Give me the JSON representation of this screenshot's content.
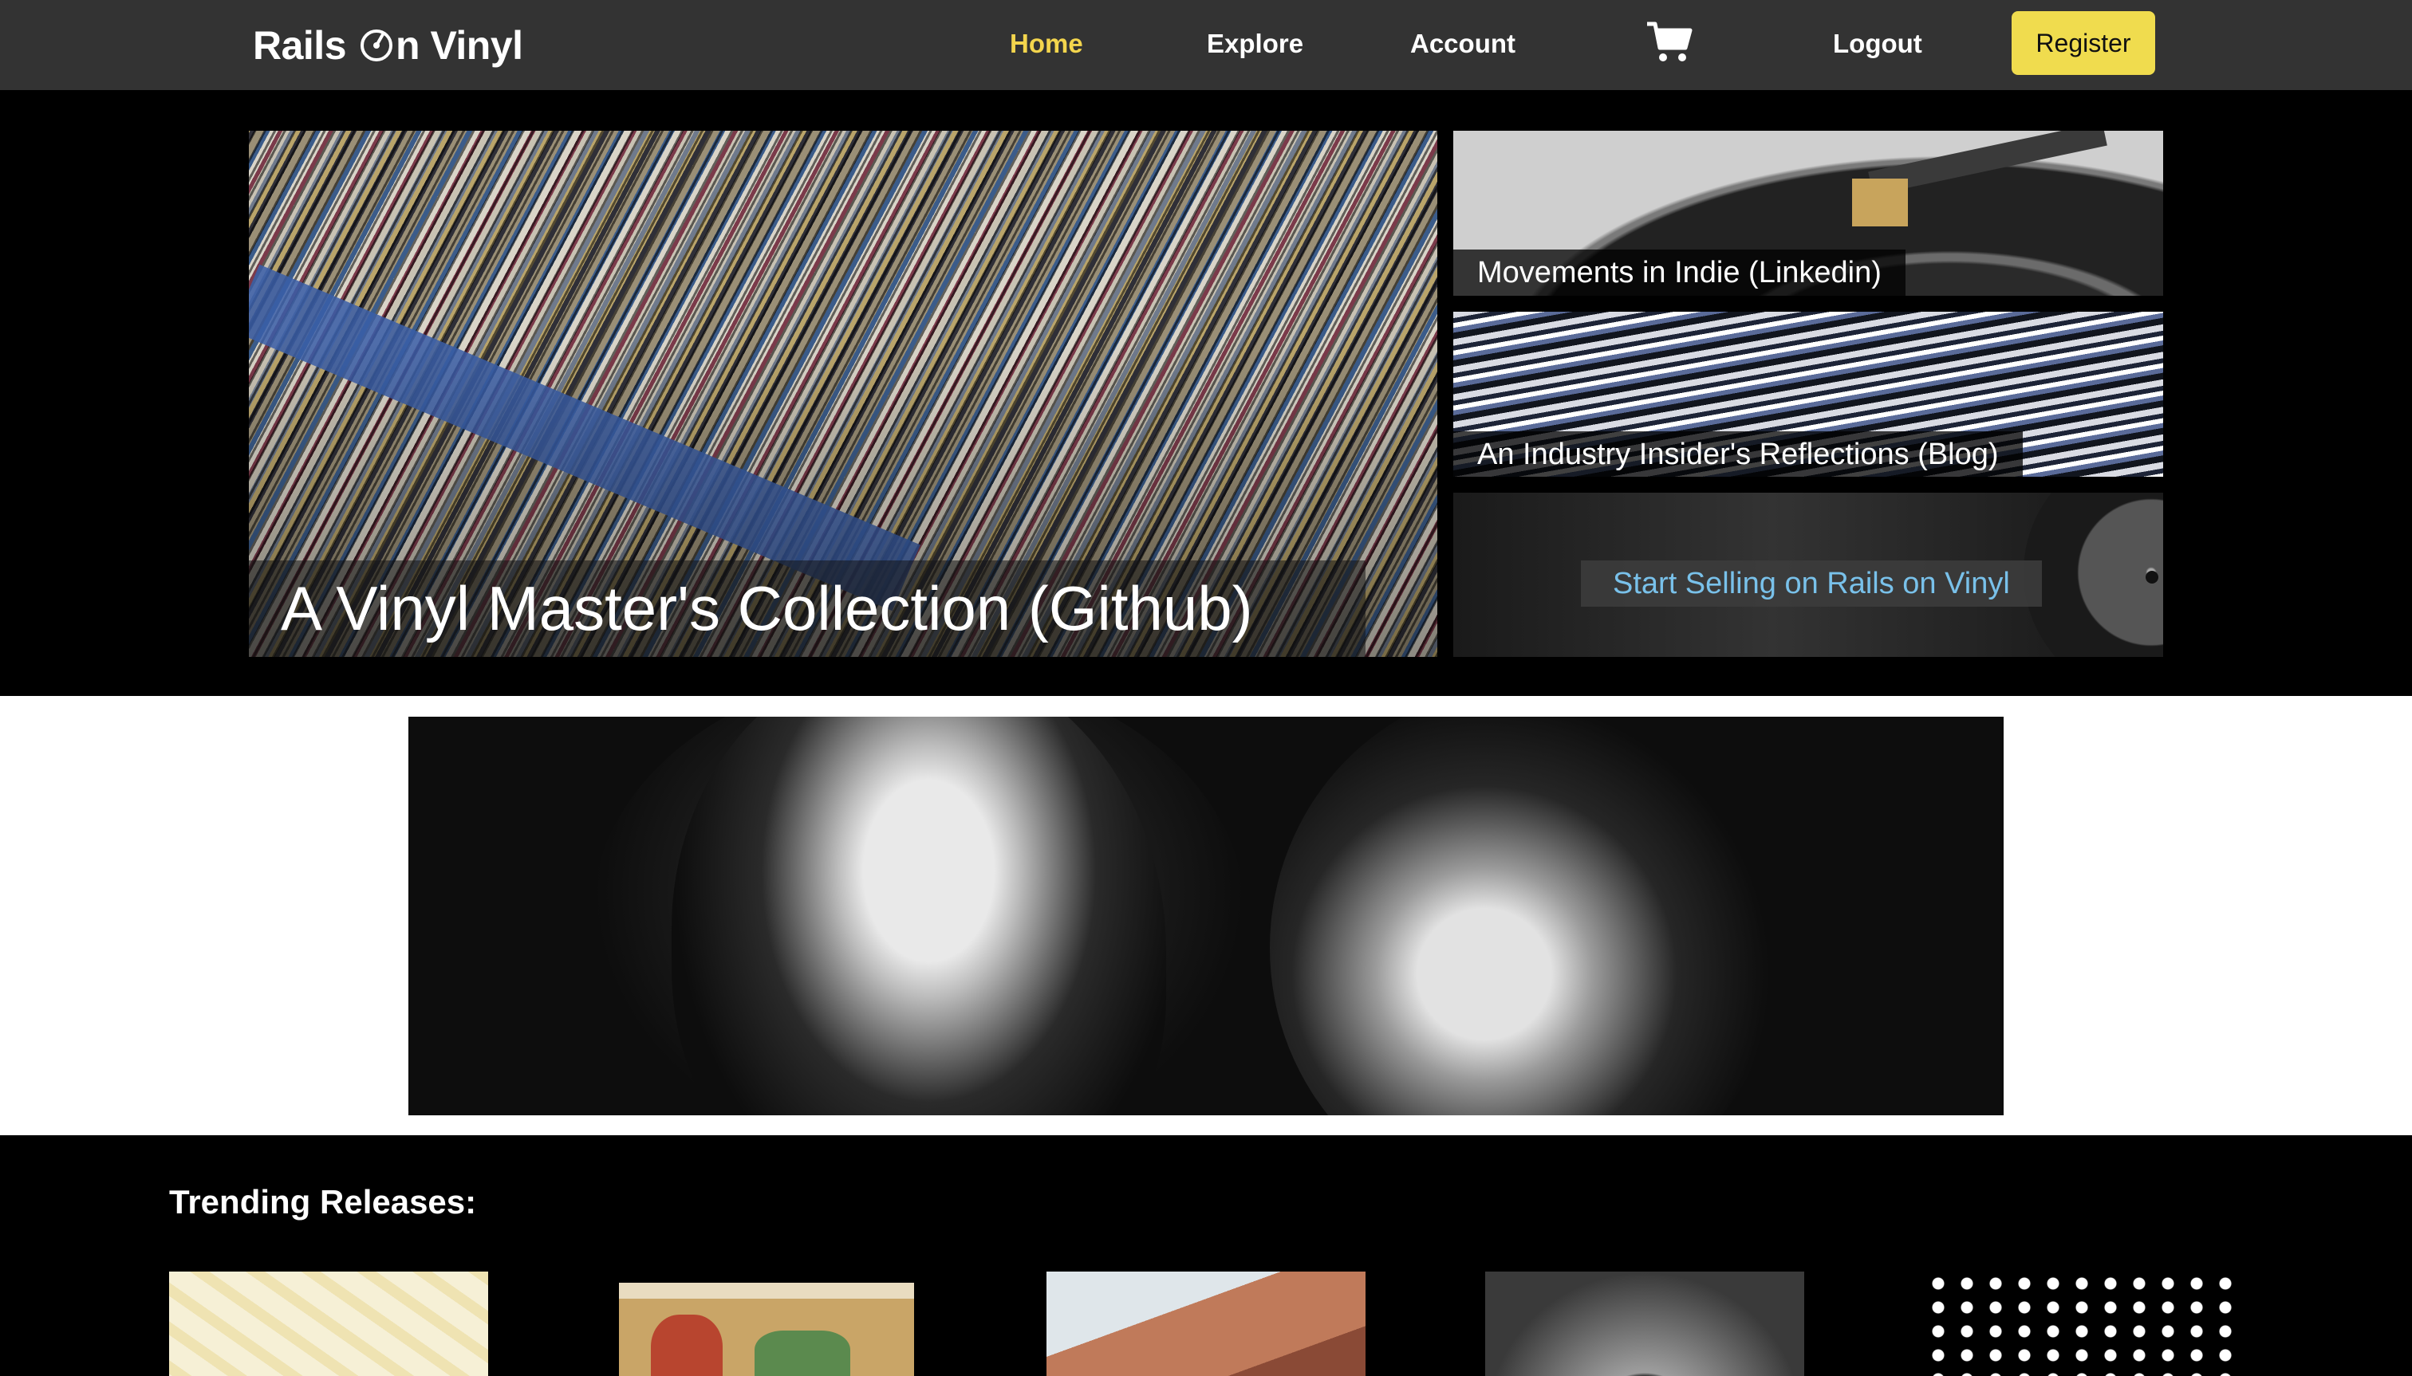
{
  "brand": {
    "part1": "Rails",
    "part2": "n Vinyl",
    "logo_icon": "record-icon"
  },
  "nav": {
    "home": "Home",
    "explore": "Explore",
    "account": "Account",
    "cart_icon": "cart-icon",
    "logout": "Logout",
    "register": "Register"
  },
  "hero": {
    "main_title": "A Vinyl Master's Collection (Github)",
    "tile1": "Movements in Indie (Linkedin)",
    "tile2": "An Industry Insider's Reflections (Blog)",
    "tile3": "Start Selling on Rails on Vinyl"
  },
  "trending": {
    "title": "Trending Releases:"
  },
  "colors": {
    "navbar": "#333333",
    "active_link": "#f3d54d",
    "register_bg": "#f0dc4e",
    "sell_link": "#79c1ea"
  }
}
